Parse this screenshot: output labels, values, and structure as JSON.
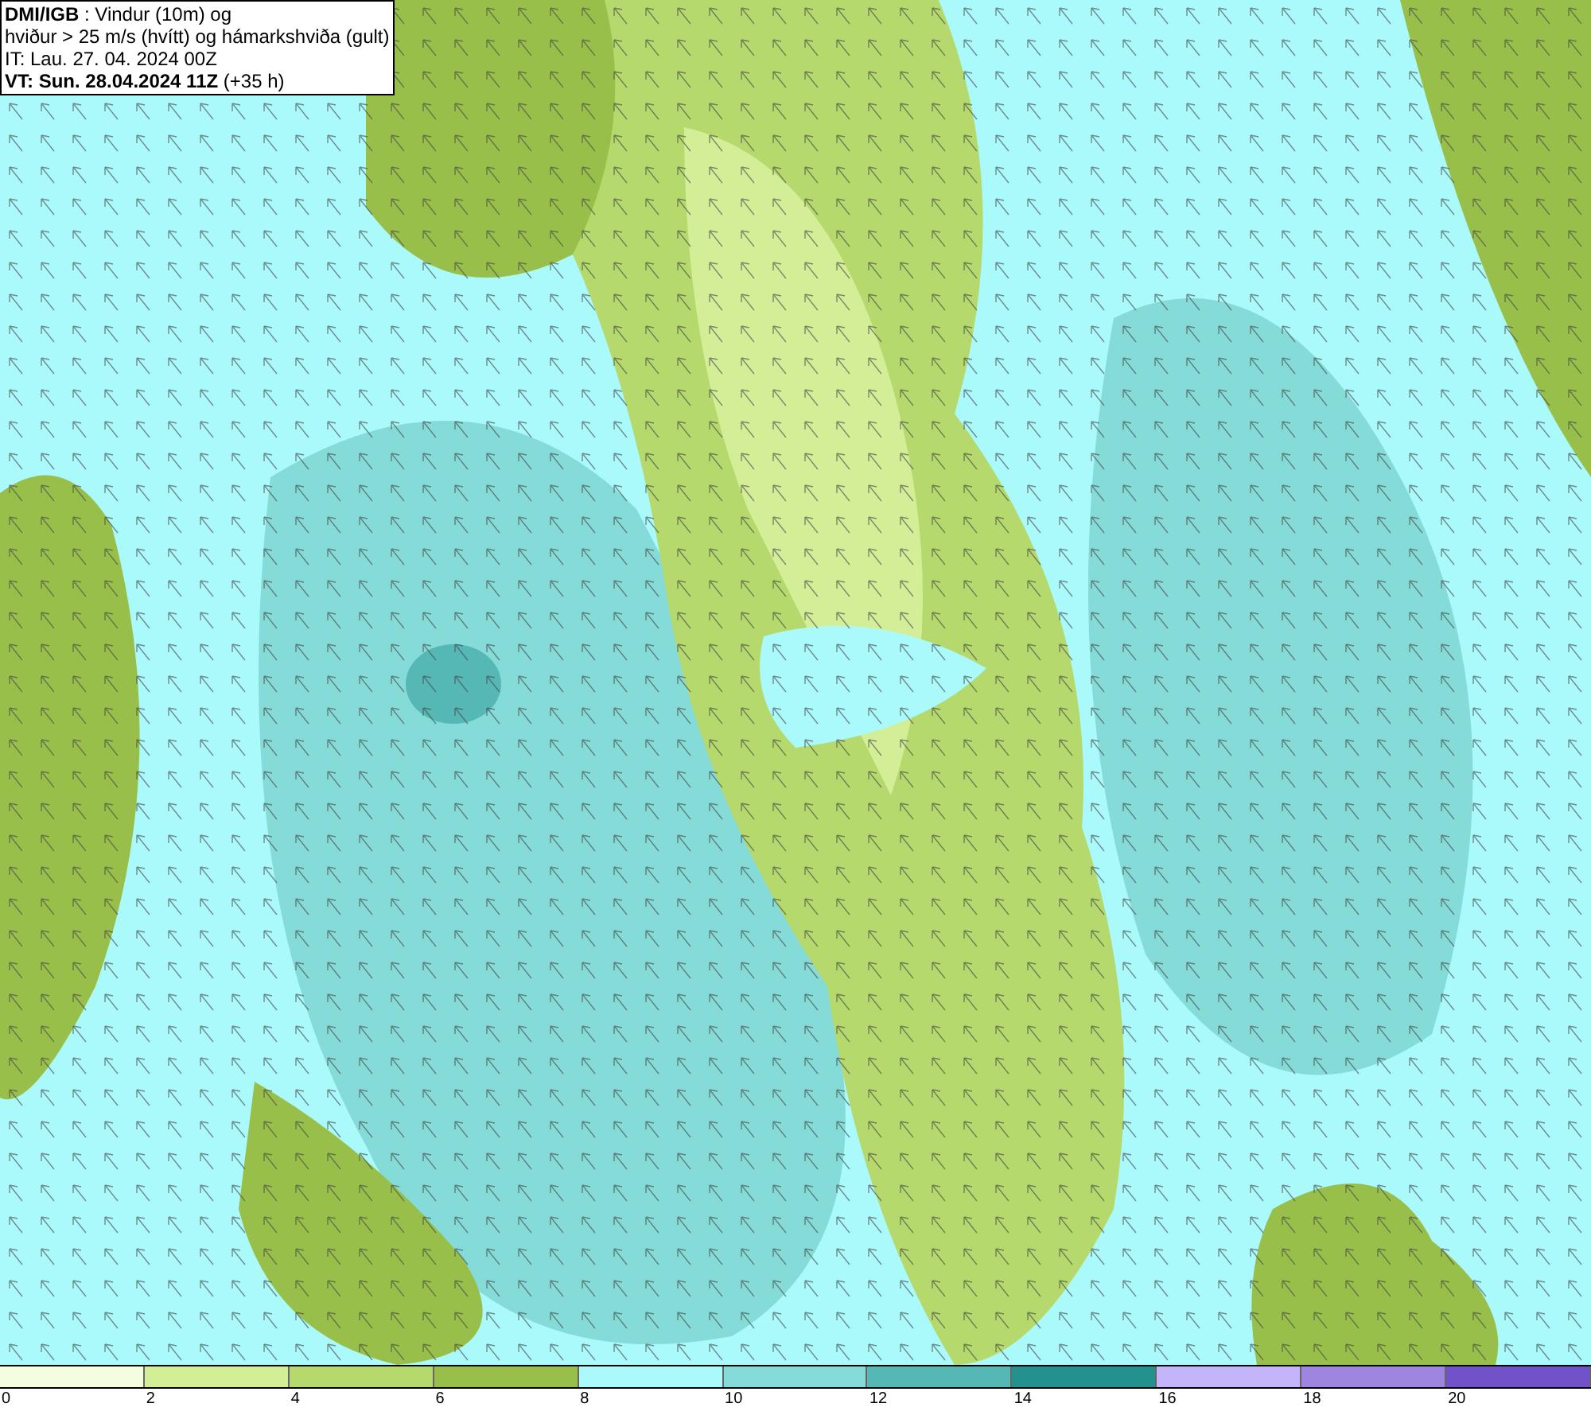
{
  "title_box": {
    "lines": [
      "**DMI/IGB** : Vindur (10m) og",
      "hviður > 25 m/s (hvítt) og hámarkshviða (gult)",
      "IT: Lau. 27. 04. 2024 00Z",
      "**VT: Sun. 28.04.2024 11Z** (+35 h)"
    ]
  },
  "legend": [
    {
      "label": "0",
      "color": "#f5fde0"
    },
    {
      "label": "2",
      "color": "#d4ee98"
    },
    {
      "label": "4",
      "color": "#b5d96c"
    },
    {
      "label": "6",
      "color": "#98bf4a"
    },
    {
      "label": "8",
      "color": "#aaf9fb"
    },
    {
      "label": "10",
      "color": "#84dbd8"
    },
    {
      "label": "12",
      "color": "#55b8b5"
    },
    {
      "label": "14",
      "color": "#23918d"
    },
    {
      "label": "16",
      "color": "#c4b5fb"
    },
    {
      "label": "18",
      "color": "#9d85e0"
    },
    {
      "label": "20",
      "color": "#7152c8"
    }
  ]
}
